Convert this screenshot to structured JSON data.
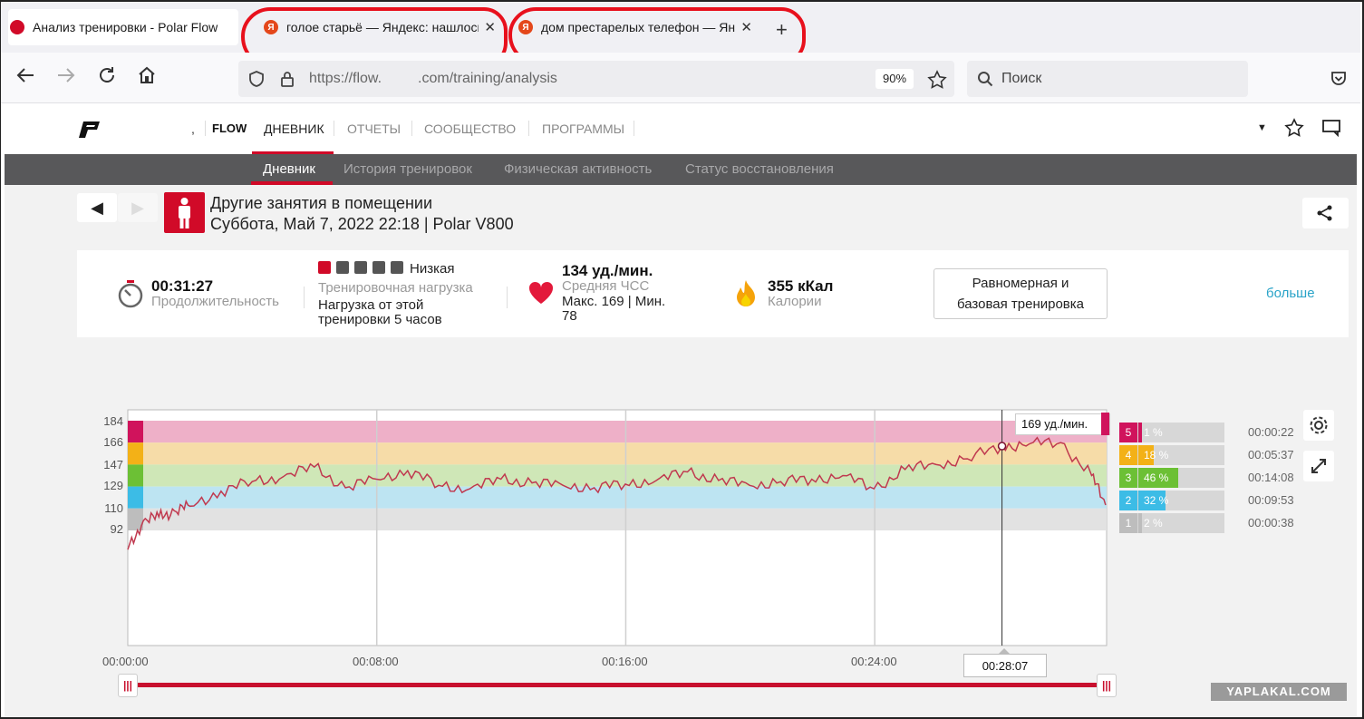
{
  "browser": {
    "tabs": [
      {
        "title": "Анализ тренировки - Polar Flow"
      },
      {
        "title": "голое старьё — Яндекс: нашлось"
      },
      {
        "title": "дом престарелых телефон — Яндекс"
      }
    ],
    "favicon_letter": "Я",
    "close_glyph": "✕",
    "new_tab_glyph": "+",
    "url_prefix": "https://flow.",
    "url_suffix": ".com/training/analysis",
    "zoom": "90%",
    "search_placeholder": "Поиск"
  },
  "header": {
    "brand": "FLOW",
    "nav": [
      "ДНЕВНИК",
      "ОТЧЕТЫ",
      "СООБЩЕСТВО",
      "ПРОГРАММЫ"
    ],
    "dropdown_glyph": "▼",
    "comma": ","
  },
  "subnav": [
    "Дневник",
    "История тренировок",
    "Физическая активность",
    "Статус восстановления"
  ],
  "session": {
    "prev_glyph": "◀",
    "next_glyph": "▶",
    "title": "Другие занятия в помещении",
    "subtitle": "Суббота, Май 7, 2022 22:18 | Polar V800"
  },
  "summary": {
    "duration_value": "00:31:27",
    "duration_label": "Продолжительность",
    "load_level": "Низкая",
    "load_label": "Тренировочная нагрузка",
    "load_text_1": "Нагрузка от этой",
    "load_text_2": "тренировки 5 часов",
    "hr_value": "134 уд./мин.",
    "hr_label": "Средняя ЧСС",
    "hr_minmax_1": "Макс. 169  |  Мин.",
    "hr_minmax_2": "78",
    "cal_value": "355 кКал",
    "cal_label": "Калории",
    "type_1": "Равномерная и",
    "type_2": "базовая тренировка",
    "more": "больше"
  },
  "chart": {
    "y_ticks": [
      "184",
      "166",
      "147",
      "129",
      "110",
      "92"
    ],
    "x_ticks": [
      "00:00:00",
      "00:08:00",
      "00:16:00",
      "00:24:00"
    ],
    "tooltip": "169 уд./мин.",
    "cursor_time": "00:28:07"
  },
  "zones": [
    {
      "num": "5",
      "pct": "1 %",
      "time": "00:00:22",
      "frac": 0.01,
      "color": "#d0135c"
    },
    {
      "num": "4",
      "pct": "18 %",
      "time": "00:05:37",
      "frac": 0.18,
      "color": "#f3b117"
    },
    {
      "num": "3",
      "pct": "46 %",
      "time": "00:14:08",
      "frac": 0.46,
      "color": "#6cc035"
    },
    {
      "num": "2",
      "pct": "32 %",
      "time": "00:09:53",
      "frac": 0.32,
      "color": "#3cbce6"
    },
    {
      "num": "1",
      "pct": "2 %",
      "time": "00:00:38",
      "frac": 0.02,
      "color": "#bdbdbd"
    }
  ],
  "chart_data": {
    "type": "line",
    "x": [
      "00:00:00",
      "00:00:30",
      "00:01:00",
      "00:01:30",
      "00:02:00",
      "00:03:00",
      "00:04:00",
      "00:05:00",
      "00:06:00",
      "00:07:00",
      "00:08:00",
      "00:09:00",
      "00:10:00",
      "00:11:00",
      "00:12:00",
      "00:13:00",
      "00:14:00",
      "00:15:00",
      "00:16:00",
      "00:17:00",
      "00:18:00",
      "00:19:00",
      "00:20:00",
      "00:21:00",
      "00:22:00",
      "00:23:00",
      "00:24:00",
      "00:25:00",
      "00:26:00",
      "00:27:00",
      "00:28:07",
      "00:29:00",
      "00:30:00",
      "00:31:00",
      "00:31:27"
    ],
    "series": [
      {
        "values": [
          80,
          100,
          103,
          108,
          112,
          125,
          133,
          137,
          145,
          128,
          135,
          142,
          130,
          127,
          135,
          132,
          130,
          128,
          131,
          134,
          141,
          134,
          130,
          133,
          135,
          138,
          127,
          143,
          147,
          152,
          163,
          165,
          166,
          138,
          113
        ]
      }
    ],
    "xlim": [
      "00:00:00",
      "00:31:27"
    ],
    "ylim": [
      20,
      184
    ],
    "zone_bounds": [
      92,
      110,
      129,
      147,
      166,
      184
    ],
    "grid": true
  },
  "watermark": "YAPLAKAL.COM"
}
